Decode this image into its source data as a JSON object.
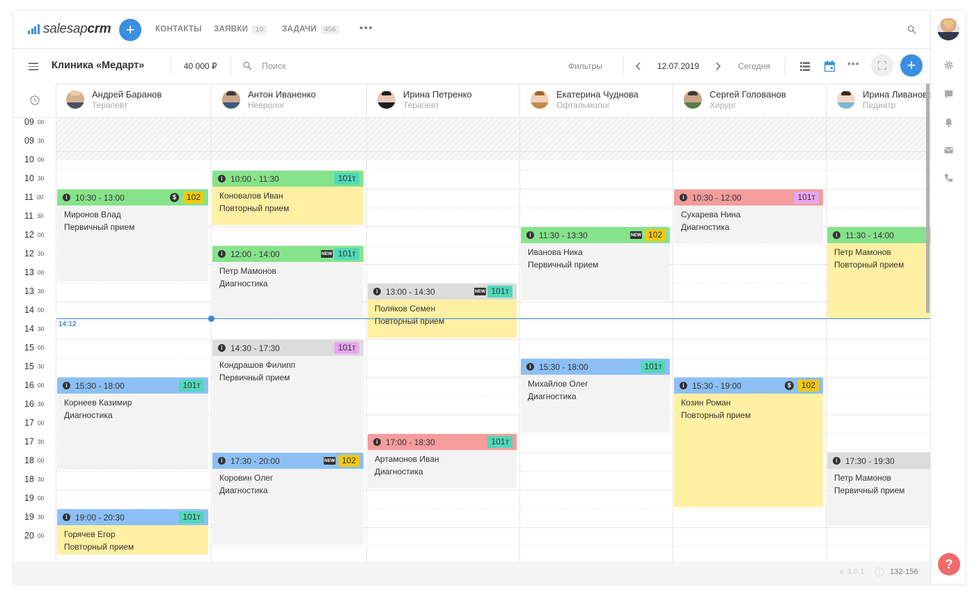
{
  "nav": {
    "logo_sales": "salesap",
    "logo_crm": "crm",
    "add_label": "+",
    "items": [
      {
        "label": "КОНТАКТЫ",
        "badge": ""
      },
      {
        "label": "ЗАЯВКИ",
        "badge": "10"
      },
      {
        "label": "ЗАДАЧИ",
        "badge": "456"
      }
    ],
    "more_label": "•••"
  },
  "toolbar": {
    "title": "Клиника «Медарт»",
    "amount": "40 000 ₽",
    "search_placeholder": "Поиск",
    "filters_label": "Фильтры",
    "date": "12.07.2019",
    "today_label": "Сегодня",
    "more_label": "•••",
    "add_label": "+"
  },
  "time_slots": [
    {
      "h": "09",
      "m": "00"
    },
    {
      "h": "09",
      "m": "30"
    },
    {
      "h": "10",
      "m": "00"
    },
    {
      "h": "10",
      "m": "30"
    },
    {
      "h": "11",
      "m": "00"
    },
    {
      "h": "11",
      "m": "30"
    },
    {
      "h": "12",
      "m": "00"
    },
    {
      "h": "12",
      "m": "30"
    },
    {
      "h": "13",
      "m": "00"
    },
    {
      "h": "13",
      "m": "30"
    },
    {
      "h": "14",
      "m": "00"
    },
    {
      "h": "14",
      "m": "30"
    },
    {
      "h": "15",
      "m": "00"
    },
    {
      "h": "15",
      "m": "30"
    },
    {
      "h": "16",
      "m": "00"
    },
    {
      "h": "16",
      "m": "30"
    },
    {
      "h": "17",
      "m": "00"
    },
    {
      "h": "17",
      "m": "30"
    },
    {
      "h": "18",
      "m": "00"
    },
    {
      "h": "18",
      "m": "30"
    },
    {
      "h": "19",
      "m": "00"
    },
    {
      "h": "19",
      "m": "30"
    },
    {
      "h": "20",
      "m": "00"
    }
  ],
  "doctors": [
    {
      "name": "Андрей Баранов",
      "specialty": "Терапевт"
    },
    {
      "name": "Антон Иваненко",
      "specialty": "Невролог"
    },
    {
      "name": "Ирина Петренко",
      "specialty": "Терапевт"
    },
    {
      "name": "Екатерина Чуднова",
      "specialty": "Офтальмолог"
    },
    {
      "name": "Сергей Голованов",
      "specialty": "Хирург"
    },
    {
      "name": "Ирина Ливанова",
      "specialty": "Педиатр"
    }
  ],
  "current_time": "14:12",
  "colors": {
    "green": "#86e38b",
    "gray": "#dcdcdc",
    "red": "#f59c9c",
    "blue": "#8cc0f5",
    "yellow": "#fff0a3",
    "body_gray": "#f3f3f3",
    "room_yellow": "#f2c811",
    "room_teal": "#4fd9b8",
    "room_pink": "#e9a6ef",
    "accent": "#3b8fe0"
  },
  "events": [
    {
      "col": 0,
      "start": 10.5,
      "end": 13.0,
      "time": "10:30 - 13:00",
      "room": "102",
      "room_color": "room_yellow",
      "header": "green",
      "body": "body_gray",
      "dollar": true,
      "isnew": false,
      "patient": "Миронов Влад",
      "visit": "Первичный прием"
    },
    {
      "col": 0,
      "start": 15.5,
      "end": 18.0,
      "time": "15:30 - 18:00",
      "room": "101т",
      "room_color": "room_teal",
      "header": "blue",
      "body": "body_gray",
      "dollar": false,
      "isnew": false,
      "patient": "Корнеев Казимир",
      "visit": "Диагностика"
    },
    {
      "col": 0,
      "start": 19.0,
      "end": 20.25,
      "time": "19:00 - 20:30",
      "room": "101т",
      "room_color": "room_teal",
      "header": "blue",
      "body": "yellow",
      "dollar": false,
      "isnew": false,
      "patient": "Горячев Егор",
      "visit": "Повторный прием"
    },
    {
      "col": 1,
      "start": 10.0,
      "end": 11.5,
      "time": "10:00 - 11:30",
      "room": "101т",
      "room_color": "room_teal",
      "header": "green",
      "body": "yellow",
      "dollar": false,
      "isnew": false,
      "patient": "Коновалов Иван",
      "visit": "Повторный прием"
    },
    {
      "col": 1,
      "start": 12.0,
      "end": 14.0,
      "time": "12:00 - 14:00",
      "room": "101т",
      "room_color": "room_teal",
      "header": "green",
      "body": "body_gray",
      "dollar": false,
      "isnew": true,
      "patient": "Петр Мамонов",
      "visit": "Диагностика"
    },
    {
      "col": 1,
      "start": 14.5,
      "end": 17.5,
      "time": "14:30 - 17:30",
      "room": "101т",
      "room_color": "room_pink",
      "header": "gray",
      "body": "body_gray",
      "dollar": false,
      "isnew": false,
      "patient": "Кондрашов Филипп",
      "visit": "Первичный прием"
    },
    {
      "col": 1,
      "start": 17.5,
      "end": 20.0,
      "time": "17:30 - 20:00",
      "room": "102",
      "room_color": "room_yellow",
      "header": "blue",
      "body": "body_gray",
      "dollar": false,
      "isnew": true,
      "patient": "Коровин Олег",
      "visit": "Диагностика"
    },
    {
      "col": 2,
      "start": 13.0,
      "end": 14.5,
      "time": "13:00 - 14:30",
      "room": "101т",
      "room_color": "room_teal",
      "header": "gray",
      "body": "yellow",
      "dollar": false,
      "isnew": true,
      "patient": "Поляков Семен",
      "visit": "Повторный прием"
    },
    {
      "col": 2,
      "start": 17.0,
      "end": 18.5,
      "time": "17:00 - 18:30",
      "room": "101т",
      "room_color": "room_teal",
      "header": "red",
      "body": "body_gray",
      "dollar": false,
      "isnew": false,
      "patient": "Артамонов Иван",
      "visit": "Диагностика"
    },
    {
      "col": 3,
      "start": 11.5,
      "end": 13.5,
      "time": "11:30 - 13:30",
      "room": "102",
      "room_color": "room_yellow",
      "header": "green",
      "body": "body_gray",
      "dollar": false,
      "isnew": true,
      "patient": "Иванова Ника",
      "visit": "Первичный прием"
    },
    {
      "col": 3,
      "start": 15.0,
      "end": 17.0,
      "time": "15:30 - 18:00",
      "room": "101т",
      "room_color": "room_teal",
      "header": "blue",
      "body": "body_gray",
      "dollar": false,
      "isnew": false,
      "patient": "Михайлов Олег",
      "visit": "Диагностика"
    },
    {
      "col": 4,
      "start": 10.5,
      "end": 12.0,
      "time": "10:30 - 12:00",
      "room": "101т",
      "room_color": "room_pink",
      "header": "red",
      "body": "body_gray",
      "dollar": false,
      "isnew": false,
      "patient": "Сухарева Нина",
      "visit": "Диагностика"
    },
    {
      "col": 4,
      "start": 15.5,
      "end": 19.0,
      "time": "15:30 - 19:00",
      "room": "102",
      "room_color": "room_yellow",
      "header": "blue",
      "body": "yellow",
      "dollar": true,
      "isnew": false,
      "patient": "Козин Роман",
      "visit": "Повторный прием"
    },
    {
      "col": 5,
      "start": 11.5,
      "end": 14.0,
      "time": "11:30 - 14:00",
      "room": "",
      "room_color": "room_teal",
      "header": "green",
      "body": "yellow",
      "dollar": false,
      "isnew": false,
      "patient": "Петр Мамонов",
      "visit": "Повторный прием"
    },
    {
      "col": 5,
      "start": 17.5,
      "end": 19.5,
      "time": "17:30 - 19:30",
      "room": "",
      "room_color": "room_teal",
      "header": "gray",
      "body": "body_gray",
      "dollar": false,
      "isnew": false,
      "patient": "Петр Мамонов",
      "visit": "Первичный прием"
    }
  ],
  "footer": {
    "version": "v. 3.0.1",
    "build": "132-156"
  },
  "sidebar_icons": [
    "gear-icon",
    "chat-icon",
    "bell-icon",
    "mail-icon",
    "phone-icon"
  ],
  "help_label": "?"
}
